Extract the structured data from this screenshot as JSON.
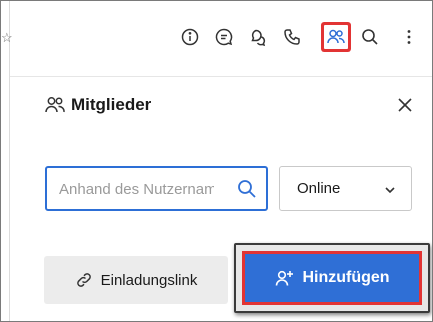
{
  "toolbar": {
    "icons": [
      "info-icon",
      "chat-icon",
      "threads-icon",
      "phone-icon",
      "members-icon",
      "search-icon",
      "more-icon"
    ],
    "edge_glyph": "☆"
  },
  "panel": {
    "title": "Mitglieder",
    "search": {
      "placeholder": "Anhand des Nutzernamens suchen",
      "value": ""
    },
    "status_filter": {
      "selected": "Online"
    },
    "invite_button": "Einladungslink",
    "add_button": "Hinzufügen"
  },
  "colors": {
    "accent": "#2f6fd6",
    "highlight": "#e23434",
    "secondary_button": "#ececec"
  }
}
